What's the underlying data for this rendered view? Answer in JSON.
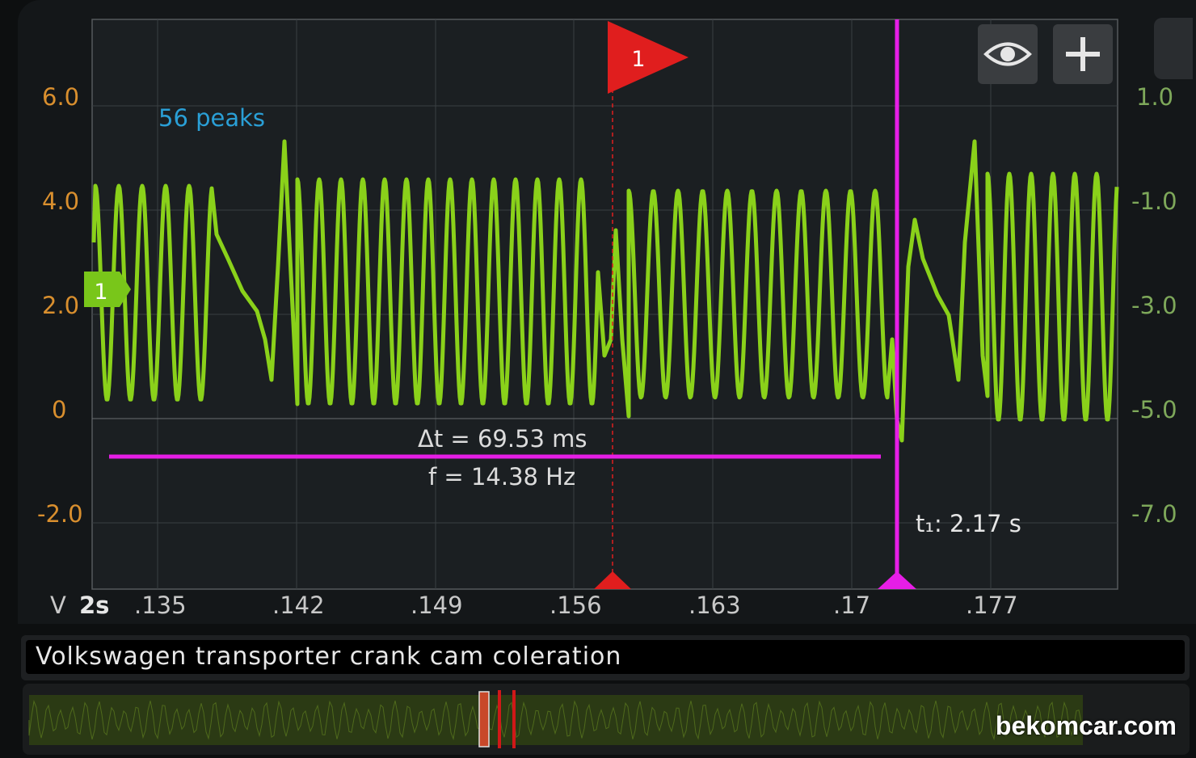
{
  "colors": {
    "trace": "#8ad11a",
    "cursor": "#e61ee6",
    "marker": "#e01e1e",
    "left_axis": "#d98f2e",
    "right_axis": "#7ea85a",
    "peaks_text": "#2a9fd6"
  },
  "scope": {
    "left_axis_labels": [
      "6.0",
      "4.0",
      "2.0",
      "0",
      "-2.0"
    ],
    "right_axis_labels": [
      "1.0",
      "-1.0",
      "-3.0",
      "-5.0",
      "-7.0"
    ],
    "x_unit": "V",
    "timebase": "2s",
    "x_tick_labels": [
      ".135",
      ".142",
      ".149",
      ".156",
      ".163",
      ".17",
      ".177"
    ],
    "peaks_label": "56 peaks",
    "channel_marker": "1",
    "flag_marker": "1",
    "delta_t": "Δt = 69.53 ms",
    "frequency": "f = 14.38 Hz",
    "cursor_t1": "t₁: 2.17 s"
  },
  "buttons": {
    "visibility_icon": "eye-icon",
    "add_icon": "plus-icon"
  },
  "recording_title": "Volkswagen transporter crank cam coleration",
  "watermark": "bekomcar.com"
}
